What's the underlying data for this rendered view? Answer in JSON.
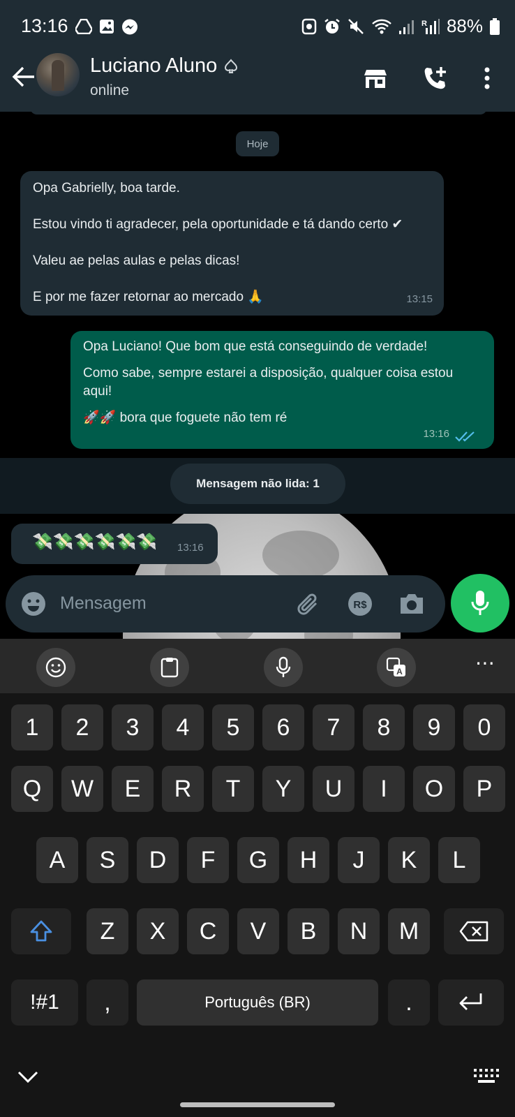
{
  "status_bar": {
    "time": "13:16",
    "battery": "88%",
    "left_icons": [
      "drive-icon",
      "gallery-icon",
      "messenger-icon"
    ],
    "right_icons": [
      "screenshot-icon",
      "alarm-icon",
      "mute-icon",
      "wifi-icon",
      "signal-icon",
      "roaming-signal-icon",
      "battery-icon"
    ]
  },
  "header": {
    "contact_name": "Luciano Aluno",
    "contact_status": "online"
  },
  "chat": {
    "day_chip": "Hoje",
    "messages": [
      {
        "direction": "incoming",
        "lines": [
          "Opa Gabrielly, boa tarde.",
          "",
          "Estou vindo ti agradecer, pela oportunidade e tá dando certo ✔",
          "",
          "Valeu ae pelas aulas e pelas dicas!",
          "",
          "E por me fazer retornar ao mercado 🙏"
        ],
        "time": "13:15"
      },
      {
        "direction": "outgoing",
        "lines": [
          "Opa Luciano! Que bom que está conseguindo de verdade!",
          "",
          "Como sabe, sempre estarei a disposição, qualquer coisa estou",
          "aqui!",
          "",
          "🚀🚀 bora que foguete não tem ré"
        ],
        "time": "13:16",
        "read": true
      },
      {
        "direction": "incoming",
        "lines": [
          "💸💸💸💸💸💸"
        ],
        "time": "13:16"
      }
    ],
    "unread_label": "Mensagem não lida: 1"
  },
  "composer": {
    "placeholder": "Mensagem"
  },
  "keyboard": {
    "number_row": [
      "1",
      "2",
      "3",
      "4",
      "5",
      "6",
      "7",
      "8",
      "9",
      "0"
    ],
    "row1": [
      "Q",
      "W",
      "E",
      "R",
      "T",
      "Y",
      "U",
      "I",
      "O",
      "P"
    ],
    "row2": [
      "A",
      "S",
      "D",
      "F",
      "G",
      "H",
      "J",
      "K",
      "L"
    ],
    "row3": [
      "Z",
      "X",
      "C",
      "V",
      "B",
      "N",
      "M"
    ],
    "symbols_key": "!#1",
    "comma_key": ",",
    "space_label": "Português (BR)",
    "period_key": ".",
    "more_dots": "⋯"
  },
  "colors": {
    "header_bg": "#1f2c34",
    "incoming_bubble": "#1f2c34",
    "outgoing_bubble": "#005c4b",
    "accent_green": "#21c063",
    "read_tick": "#53bdeb"
  }
}
